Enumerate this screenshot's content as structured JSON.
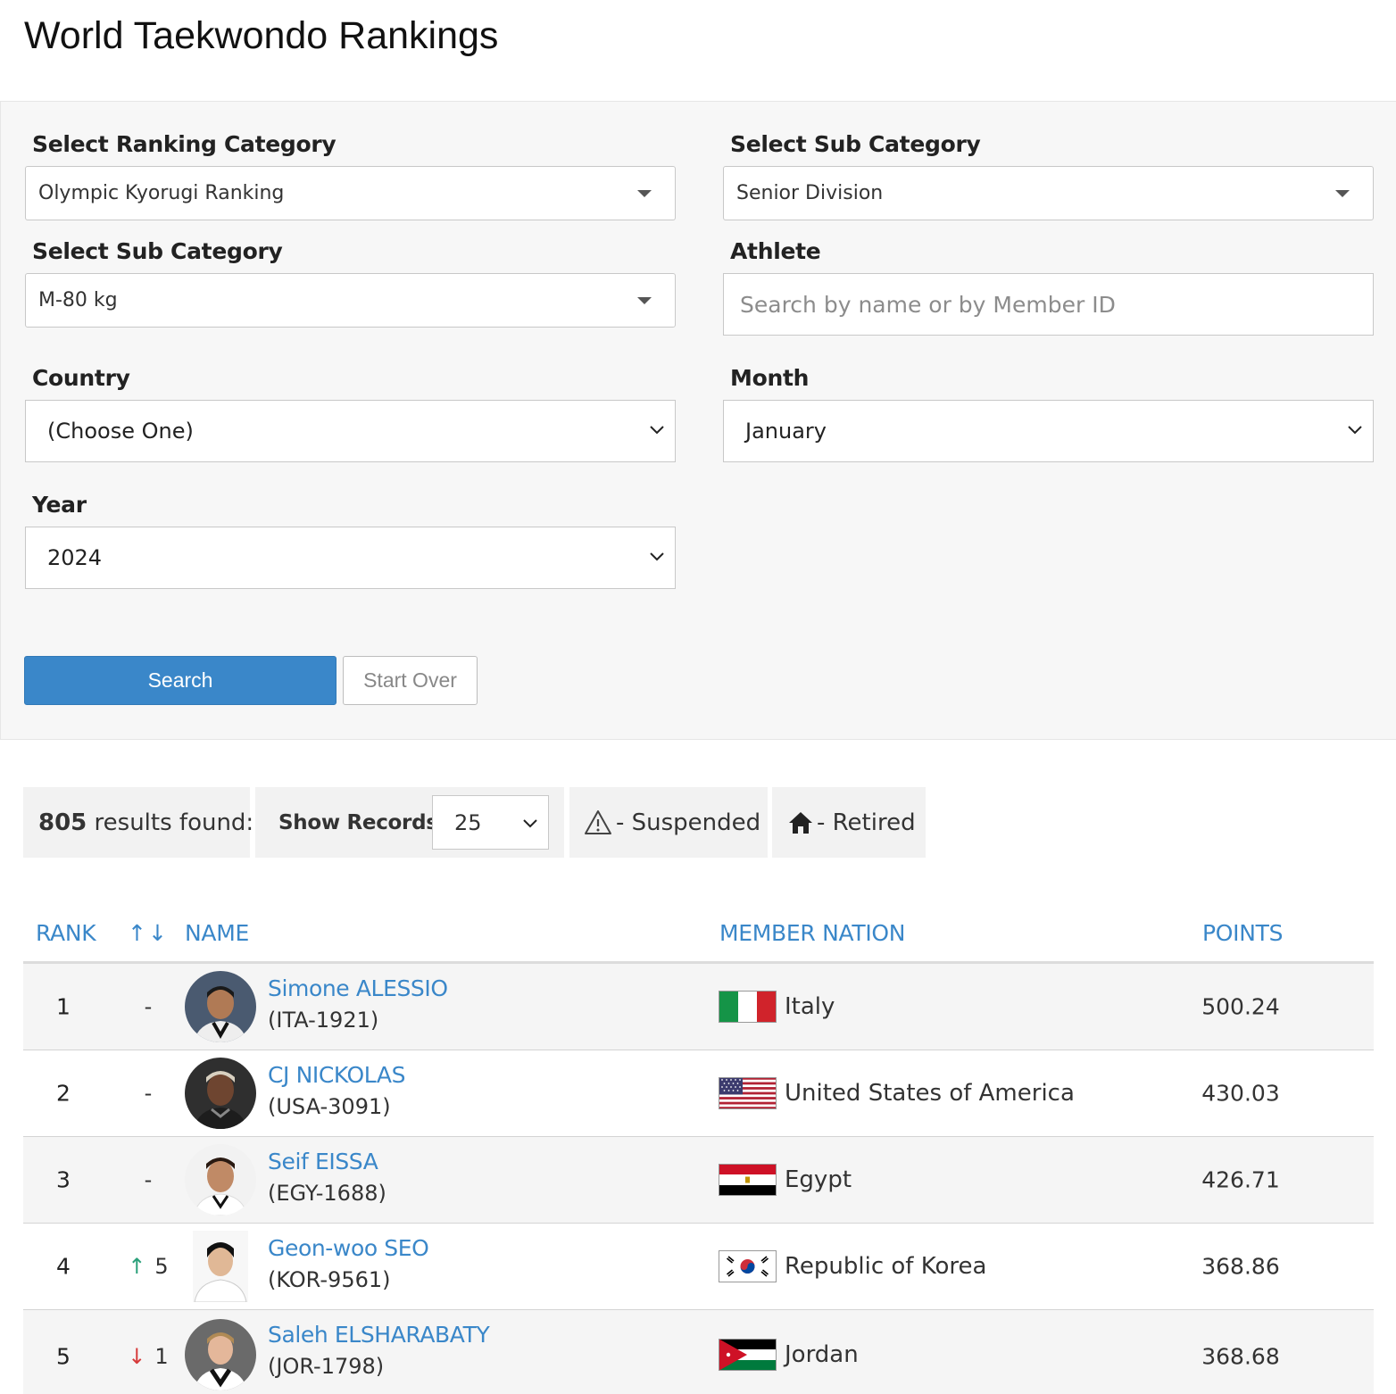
{
  "page": {
    "title": "World Taekwondo Rankings"
  },
  "filters": {
    "ranking_category": {
      "label": "Select Ranking Category",
      "value": "Olympic Kyorugi Ranking"
    },
    "division": {
      "label": "Select Sub Category",
      "value": "Senior Division"
    },
    "weight": {
      "label": "Select Sub Category",
      "value": "M-80 kg"
    },
    "athlete": {
      "label": "Athlete",
      "placeholder": "Search by name or by Member ID"
    },
    "country": {
      "label": "Country",
      "value": "(Choose One)"
    },
    "month": {
      "label": "Month",
      "value": "January"
    },
    "year": {
      "label": "Year",
      "value": "2024"
    },
    "search_button": "Search",
    "start_over_button": "Start Over"
  },
  "toolbar": {
    "results_count": "805",
    "results_suffix": " results found:",
    "show_records_label": "Show Records:",
    "show_records_value": "25",
    "legend_suspended": "- Suspended",
    "legend_retired": "- Retired"
  },
  "table": {
    "headers": {
      "rank": "RANK",
      "change": "↑↓",
      "name": "NAME",
      "nation": "MEMBER NATION",
      "points": "POINTS"
    },
    "rows": [
      {
        "rank": "1",
        "change_dir": "none",
        "change": "-",
        "name": "Simone ALESSIO",
        "member_id": "(ITA-1921)",
        "nation": "Italy",
        "flag": "italy-flag",
        "points": "500.24"
      },
      {
        "rank": "2",
        "change_dir": "none",
        "change": "-",
        "name": "CJ NICKOLAS",
        "member_id": "(USA-3091)",
        "nation": "United States of America",
        "flag": "usa-flag",
        "points": "430.03"
      },
      {
        "rank": "3",
        "change_dir": "none",
        "change": "-",
        "name": "Seif EISSA",
        "member_id": "(EGY-1688)",
        "nation": "Egypt",
        "flag": "egypt-flag",
        "points": "426.71"
      },
      {
        "rank": "4",
        "change_dir": "up",
        "change": "5",
        "name": "Geon-woo SEO",
        "member_id": "(KOR-9561)",
        "nation": "Republic of Korea",
        "flag": "korea-flag",
        "points": "368.86"
      },
      {
        "rank": "5",
        "change_dir": "down",
        "change": "1",
        "name": "Saleh ELSHARABATY",
        "member_id": "(JOR-1798)",
        "nation": "Jordan",
        "flag": "jordan-flag",
        "points": "368.68"
      }
    ]
  },
  "colors": {
    "accent": "#3a87c9",
    "up": "#2ba07a",
    "down": "#d63a3a",
    "panel": "#f7f7f7"
  }
}
